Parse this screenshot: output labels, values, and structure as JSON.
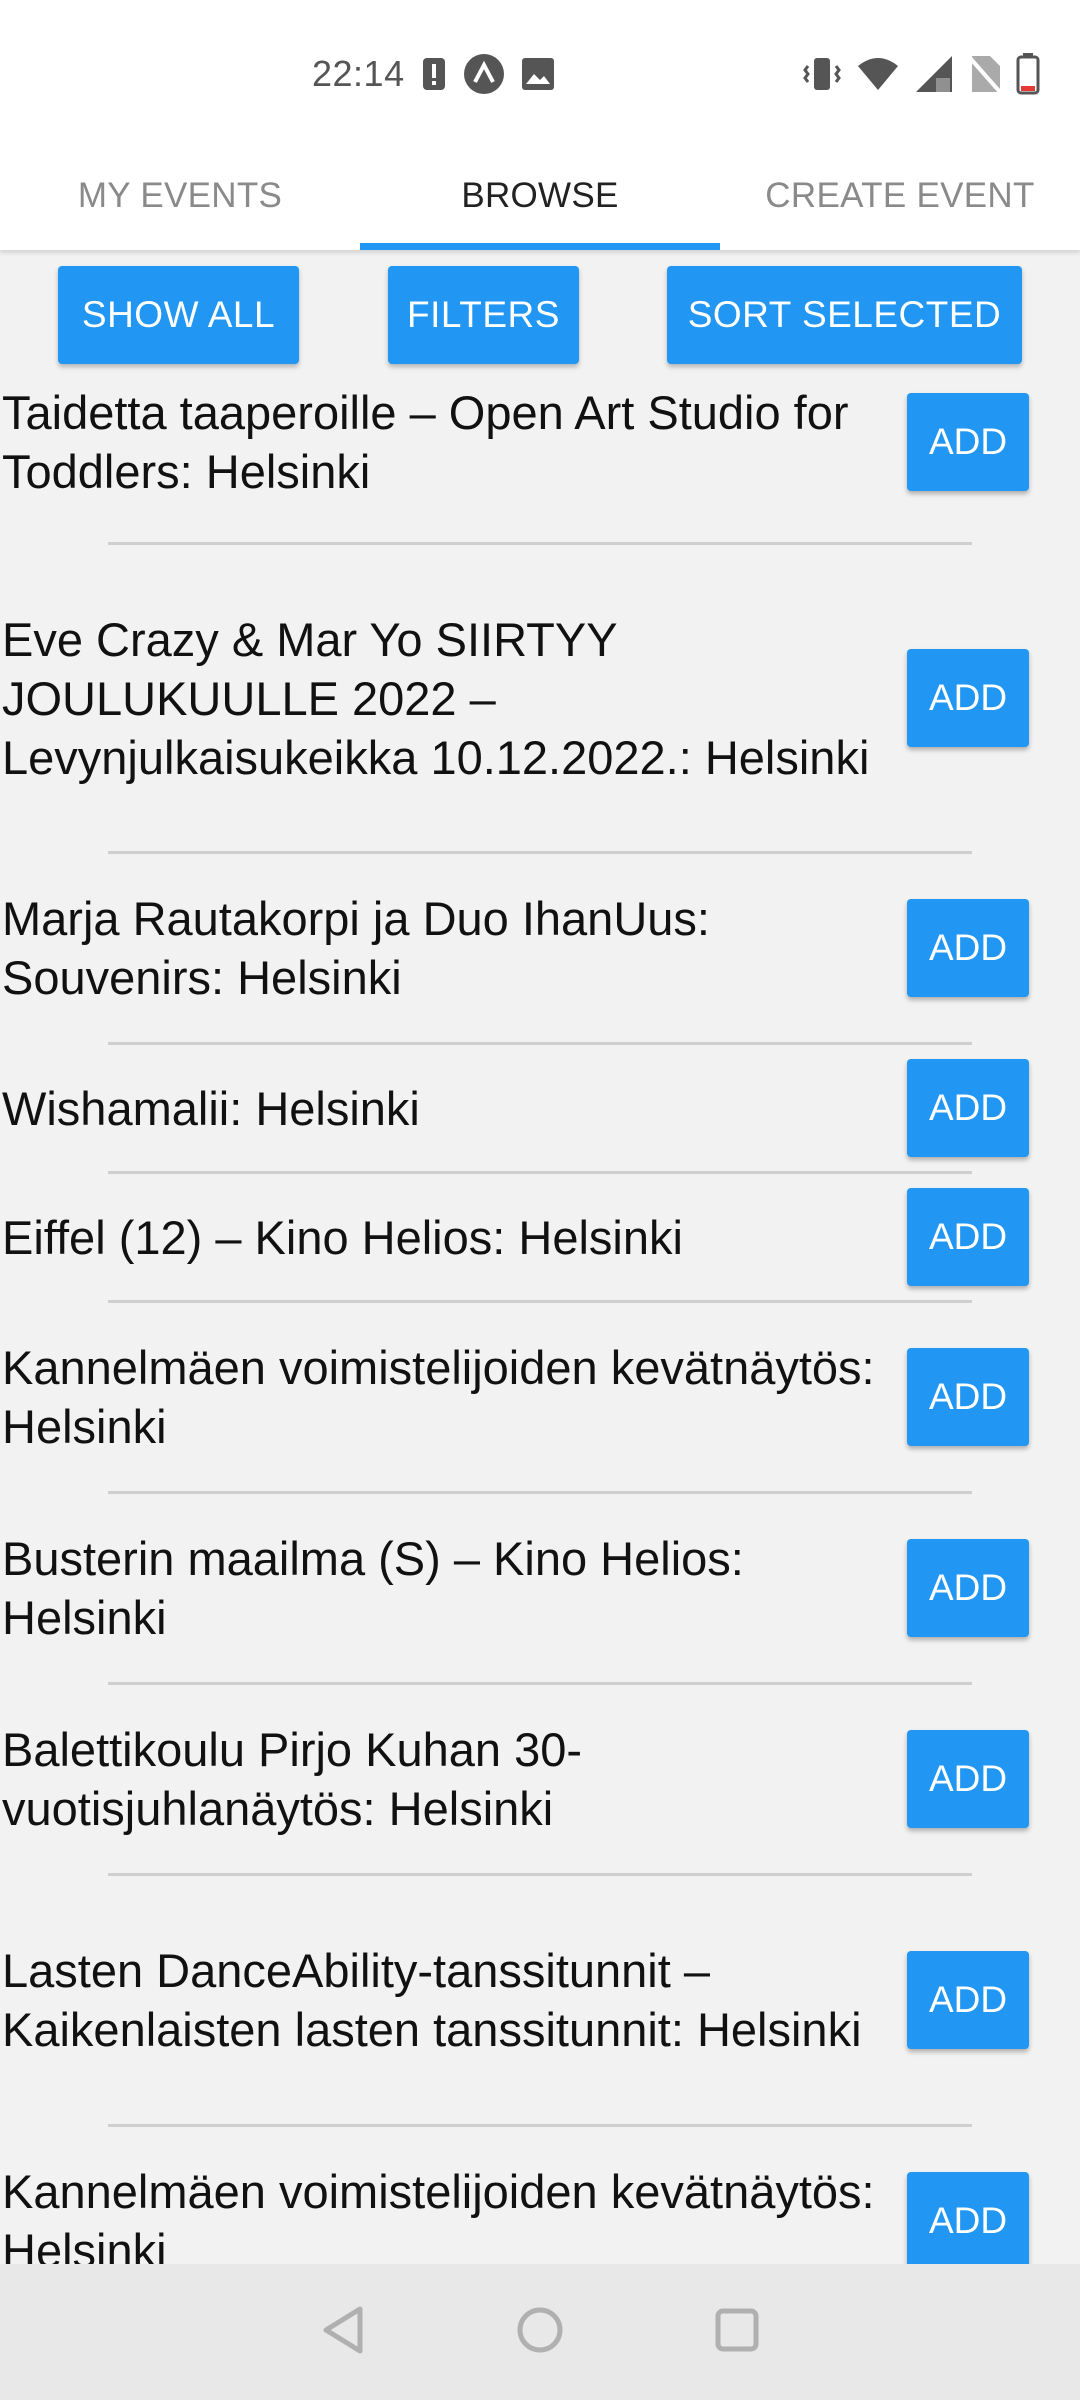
{
  "status_bar": {
    "time": "22:14",
    "icons_left": [
      "alert-icon",
      "app-icon",
      "image-icon"
    ],
    "icons_right": [
      "vibrate-icon",
      "wifi-icon",
      "signal-icon",
      "no-sim-icon",
      "battery-icon"
    ]
  },
  "tabs": [
    {
      "label": "MY EVENTS",
      "active": false
    },
    {
      "label": "BROWSE",
      "active": true
    },
    {
      "label": "CREATE EVENT",
      "active": false
    }
  ],
  "actions": {
    "show_all": "SHOW ALL",
    "filters": "FILTERS",
    "sort_selected": "SORT SELECTED"
  },
  "events": [
    {
      "title": "Taidetta taaperoille – Open Art Studio for Toddlers: Helsinki",
      "button": "ADD"
    },
    {
      "title": "Eve Crazy & Mar Yo SIIRTYY JOULUKUULLE 2022 – Levynjulkaisukeikka 10.12.2022.: Helsinki",
      "button": "ADD"
    },
    {
      "title": "Marja Rautakorpi ja Duo IhanUus: Souvenirs: Helsinki",
      "button": "ADD"
    },
    {
      "title": "Wishamalii: Helsinki",
      "button": "ADD"
    },
    {
      "title": "Eiffel (12) – Kino Helios: Helsinki",
      "button": "ADD"
    },
    {
      "title": "Kannelmäen voimistelijoiden kevätnäytös: Helsinki",
      "button": "ADD"
    },
    {
      "title": "Busterin maailma (S) – Kino Helios: Helsinki",
      "button": "ADD"
    },
    {
      "title": "Balettikoulu Pirjo Kuhan 30-vuotisjuhlanäytös: Helsinki",
      "button": "ADD"
    },
    {
      "title": "Lasten DanceAbility-tanssitunnit – Kaikenlaisten lasten tanssitunnit: Helsinki",
      "button": "ADD"
    },
    {
      "title": "Kannelmäen voimistelijoiden kevätnäytös: Helsinki",
      "button": "ADD"
    }
  ],
  "nav_bar": [
    "back-icon",
    "home-icon",
    "recents-icon"
  ],
  "colors": {
    "accent": "#2196f3",
    "background": "#f2f2f2"
  }
}
